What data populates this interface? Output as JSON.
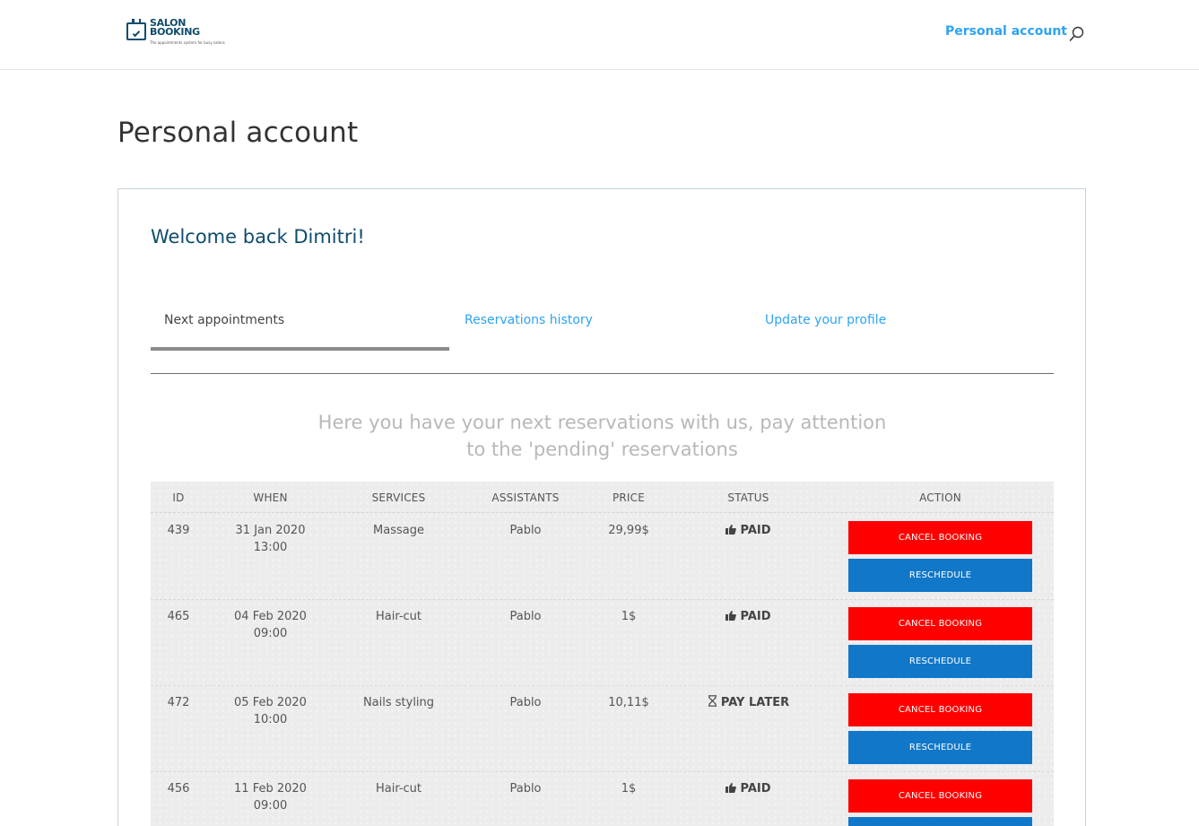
{
  "header": {
    "logo_line1": "SALON",
    "logo_line2": "BOOKING",
    "logo_tagline": "The appointments system for busy salons",
    "nav_link": "Personal account"
  },
  "page": {
    "title": "Personal account"
  },
  "account": {
    "welcome": "Welcome back Dimitri!",
    "tabs": [
      {
        "label": "Next appointments",
        "active": true
      },
      {
        "label": "Reservations history",
        "active": false
      },
      {
        "label": "Update your profile",
        "active": false
      }
    ],
    "intro_line1": "Here you have your next reservations with us, pay attention",
    "intro_line2": "to the 'pending' reservations"
  },
  "table": {
    "headers": [
      "ID",
      "WHEN",
      "SERVICES",
      "ASSISTANTS",
      "PRICE",
      "STATUS",
      "ACTION"
    ],
    "rows": [
      {
        "id": "439",
        "date": "31 Jan 2020",
        "time": "13:00",
        "service": "Massage",
        "assistant": "Pablo",
        "price": "29,99$",
        "status": "PAID",
        "status_icon": "thumbs-up-icon"
      },
      {
        "id": "465",
        "date": "04 Feb 2020",
        "time": "09:00",
        "service": "Hair-cut",
        "assistant": "Pablo",
        "price": "1$",
        "status": "PAID",
        "status_icon": "thumbs-up-icon"
      },
      {
        "id": "472",
        "date": "05 Feb 2020",
        "time": "10:00",
        "service": "Nails styling",
        "assistant": "Pablo",
        "price": "10,11$",
        "status": "PAY LATER",
        "status_icon": "hourglass-icon"
      },
      {
        "id": "456",
        "date": "11 Feb 2020",
        "time": "09:00",
        "service": "Hair-cut",
        "assistant": "Pablo",
        "price": "1$",
        "status": "PAID",
        "status_icon": "thumbs-up-icon"
      }
    ],
    "cancel_label": "CANCEL BOOKING",
    "reschedule_label": "RESCHEDULE"
  },
  "colors": {
    "accent_link": "#2ea3f2",
    "brand_navy": "#0f4c6e",
    "cancel_red": "#ff0000",
    "reschedule_blue": "#1177c8"
  }
}
